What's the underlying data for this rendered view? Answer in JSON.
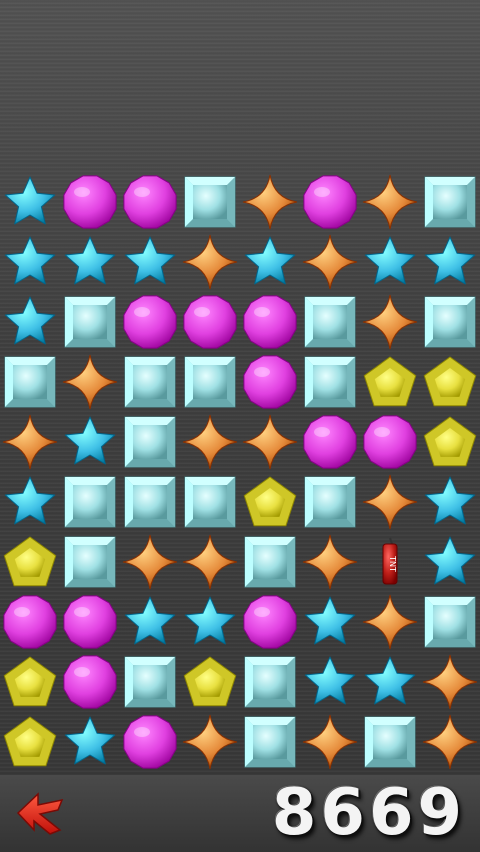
{
  "game": {
    "score": "8669",
    "board": [
      [
        "star",
        "circle",
        "circle",
        "square",
        "sparkle",
        "circle",
        "sparkle",
        "square"
      ],
      [
        "star",
        "star",
        "star",
        "sparkle",
        "star",
        "sparkle",
        "star",
        "star"
      ],
      [
        "star",
        "square",
        "circle",
        "circle",
        "circle",
        "square",
        "sparkle",
        "square"
      ],
      [
        "square",
        "sparkle",
        "square",
        "square",
        "circle",
        "square",
        "pentagon",
        "pentagon"
      ],
      [
        "sparkle",
        "star",
        "square",
        "sparkle",
        "sparkle",
        "circle",
        "circle",
        "pentagon"
      ],
      [
        "star",
        "square",
        "square",
        "square",
        "pentagon",
        "square",
        "sparkle",
        "star"
      ],
      [
        "pentagon",
        "square",
        "sparkle",
        "sparkle",
        "square",
        "sparkle",
        "tnt",
        "star"
      ],
      [
        "circle",
        "circle",
        "star",
        "star",
        "circle",
        "star",
        "sparkle",
        "square"
      ],
      [
        "pentagon",
        "circle",
        "square",
        "pentagon",
        "square",
        "star",
        "star",
        "sparkle"
      ],
      [
        "pentagon",
        "star",
        "circle",
        "sparkle",
        "square",
        "sparkle",
        "square",
        "sparkle"
      ]
    ],
    "tnt_label": "TNT"
  },
  "controls": {
    "back_icon": "red-arrow-left-icon"
  },
  "colors": {
    "star": "#3fc0e6",
    "circle": "#e040e0",
    "square": "#9fe0e4",
    "sparkle": "#e58a3a",
    "pentagon": "#e8e040",
    "tnt": "#c0201a",
    "back_arrow": "#e8201a"
  }
}
